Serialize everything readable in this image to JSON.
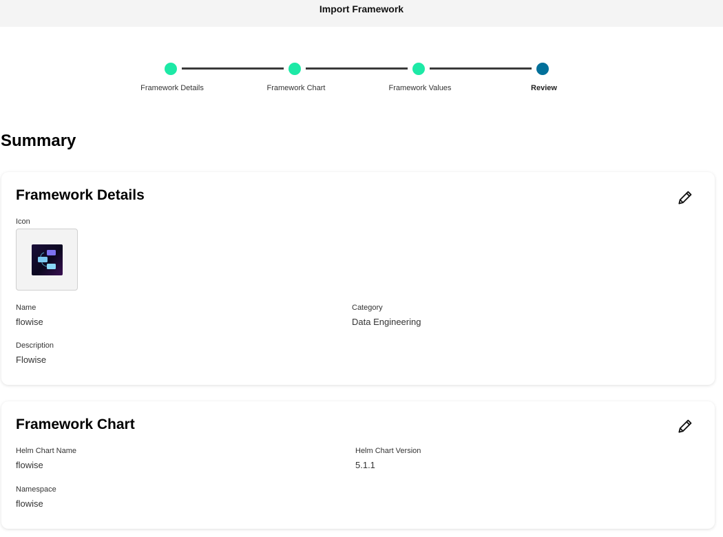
{
  "header": {
    "title": "Import Framework"
  },
  "stepper": {
    "steps": [
      {
        "label": "Framework Details",
        "state": "done"
      },
      {
        "label": "Framework Chart",
        "state": "done"
      },
      {
        "label": "Framework Values",
        "state": "done"
      },
      {
        "label": "Review",
        "state": "current"
      }
    ],
    "done_color": "#1de9a6",
    "current_color": "#02709a"
  },
  "summary": {
    "title": "Summary"
  },
  "details_card": {
    "title": "Framework Details",
    "edit_icon": "pencil-icon",
    "icon_label": "Icon",
    "app_icon": "flowise-logo",
    "name_label": "Name",
    "name_value": "flowise",
    "category_label": "Category",
    "category_value": "Data Engineering",
    "description_label": "Description",
    "description_value": "Flowise"
  },
  "chart_card": {
    "title": "Framework Chart",
    "edit_icon": "pencil-icon",
    "chart_name_label": "Helm Chart Name",
    "chart_name_value": "flowise",
    "chart_version_label": "Helm Chart Version",
    "chart_version_value": "5.1.1",
    "namespace_label": "Namespace",
    "namespace_value": "flowise"
  }
}
